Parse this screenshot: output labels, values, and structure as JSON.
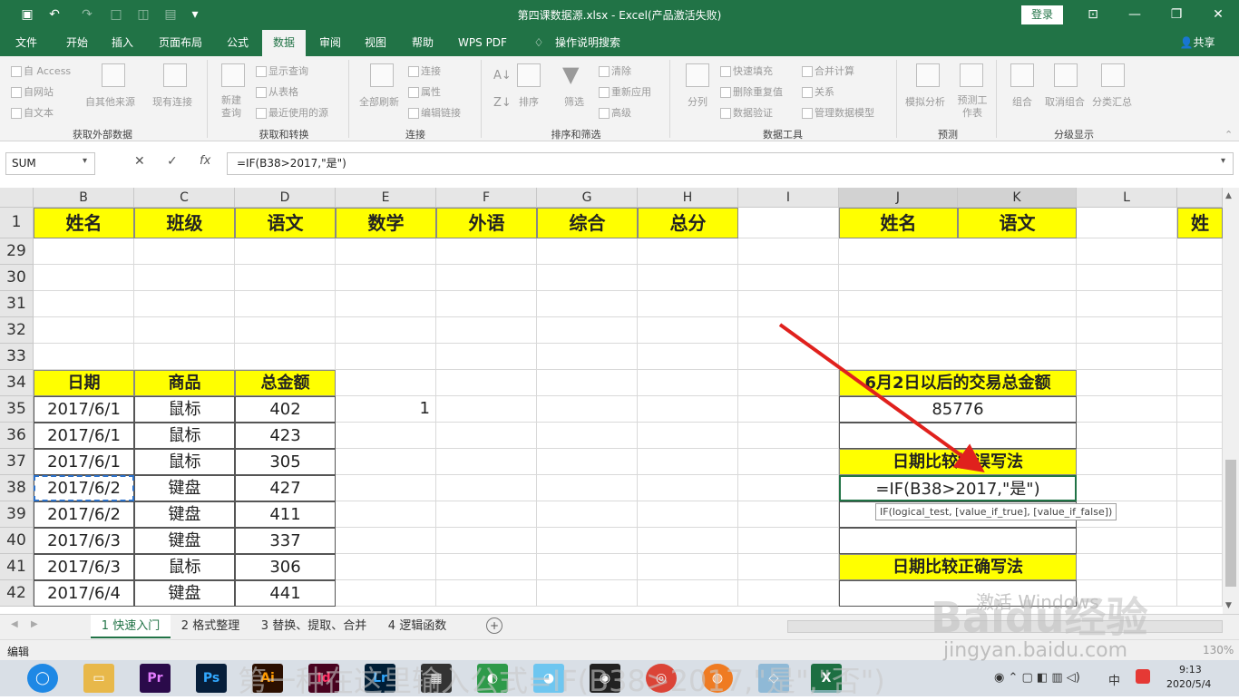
{
  "window": {
    "title": "第四课数据源.xlsx  -  Excel(产品激活失败)",
    "login": "登录"
  },
  "tabs": [
    "文件",
    "开始",
    "插入",
    "页面布局",
    "公式",
    "数据",
    "审阅",
    "视图",
    "帮助",
    "WPS PDF",
    "操作说明搜索",
    "共享"
  ],
  "ribbon": {
    "ext": {
      "access": "自 Access",
      "web": "自网站",
      "text": "自文本",
      "other": "自其他来源",
      "existing": "现有连接",
      "label": "获取外部数据"
    },
    "transform": {
      "new_query": "新建查询",
      "show": "显示查询",
      "table": "从表格",
      "recent": "最近使用的源",
      "label": "获取和转换"
    },
    "conn": {
      "refresh": "全部刷新",
      "connections": "连接",
      "props": "属性",
      "edit": "编辑链接",
      "label": "连接"
    },
    "sort": {
      "sort": "排序",
      "filter": "筛选",
      "clear": "清除",
      "reapply": "重新应用",
      "advanced": "高级",
      "label": "排序和筛选"
    },
    "tools": {
      "split": "分列",
      "flash": "快速填充",
      "dup": "删除重复值",
      "valid": "数据验证",
      "consol": "合并计算",
      "rel": "关系",
      "model": "管理数据模型",
      "label": "数据工具"
    },
    "forecast": {
      "whatif": "模拟分析",
      "sheet": "预测工作表",
      "label": "预测"
    },
    "outline": {
      "group": "组合",
      "ungroup": "取消组合",
      "subtotal": "分类汇总",
      "label": "分级显示"
    }
  },
  "formula_bar": {
    "name_box": "SUM",
    "fx": "fx",
    "formula": "=IF(B38>2017,\"是\")"
  },
  "columns": [
    "B",
    "C",
    "D",
    "E",
    "F",
    "G",
    "H",
    "I",
    "J",
    "K",
    "L"
  ],
  "header_row": {
    "num": "1",
    "cells": [
      "姓名",
      "班级",
      "语文",
      "数学",
      "外语",
      "综合",
      "总分",
      "",
      "姓名",
      "语文",
      "",
      "姓"
    ]
  },
  "rows": [
    {
      "num": "29"
    },
    {
      "num": "30"
    },
    {
      "num": "31"
    },
    {
      "num": "32"
    },
    {
      "num": "33"
    },
    {
      "num": "34",
      "b": "日期",
      "c": "商品",
      "d": "总金额",
      "j": "6月2日以后的交易总金额"
    },
    {
      "num": "35",
      "b": "2017/6/1",
      "c": "鼠标",
      "d": "402",
      "e": "1",
      "j": "85776"
    },
    {
      "num": "36",
      "b": "2017/6/1",
      "c": "鼠标",
      "d": "423"
    },
    {
      "num": "37",
      "b": "2017/6/1",
      "c": "鼠标",
      "d": "305",
      "j": "日期比较错误写法"
    },
    {
      "num": "38",
      "b": "2017/6/2",
      "c": "键盘",
      "d": "427",
      "j": "=IF(B38>2017,\"是\")"
    },
    {
      "num": "39",
      "b": "2017/6/2",
      "c": "键盘",
      "d": "411"
    },
    {
      "num": "40",
      "b": "2017/6/3",
      "c": "键盘",
      "d": "337"
    },
    {
      "num": "41",
      "b": "2017/6/3",
      "c": "鼠标",
      "d": "306",
      "j": "日期比较正确写法"
    },
    {
      "num": "42",
      "b": "2017/6/4",
      "c": "键盘",
      "d": "441"
    }
  ],
  "tooltip": "IF(logical_test, [value_if_true], [value_if_false])",
  "sheets": [
    "1 快速入门",
    "2 格式整理",
    "3 替换、提取、合并",
    "4 逻辑函数"
  ],
  "status": {
    "mode": "编辑",
    "zoom": "130%"
  },
  "taskbar": {
    "apps": [
      "Pr",
      "Ps",
      "Ai",
      "Id",
      "Lr"
    ],
    "time": "9:13",
    "date": "2020/5/4",
    "ime": "中"
  },
  "watermark": {
    "activate": "激活 Windows",
    "baidu": "Baidu经验",
    "url": "jingyan.baidu.com",
    "caption": "第一种在这里输入公式=IF(B38>2017,\"是\",\"否\")"
  }
}
